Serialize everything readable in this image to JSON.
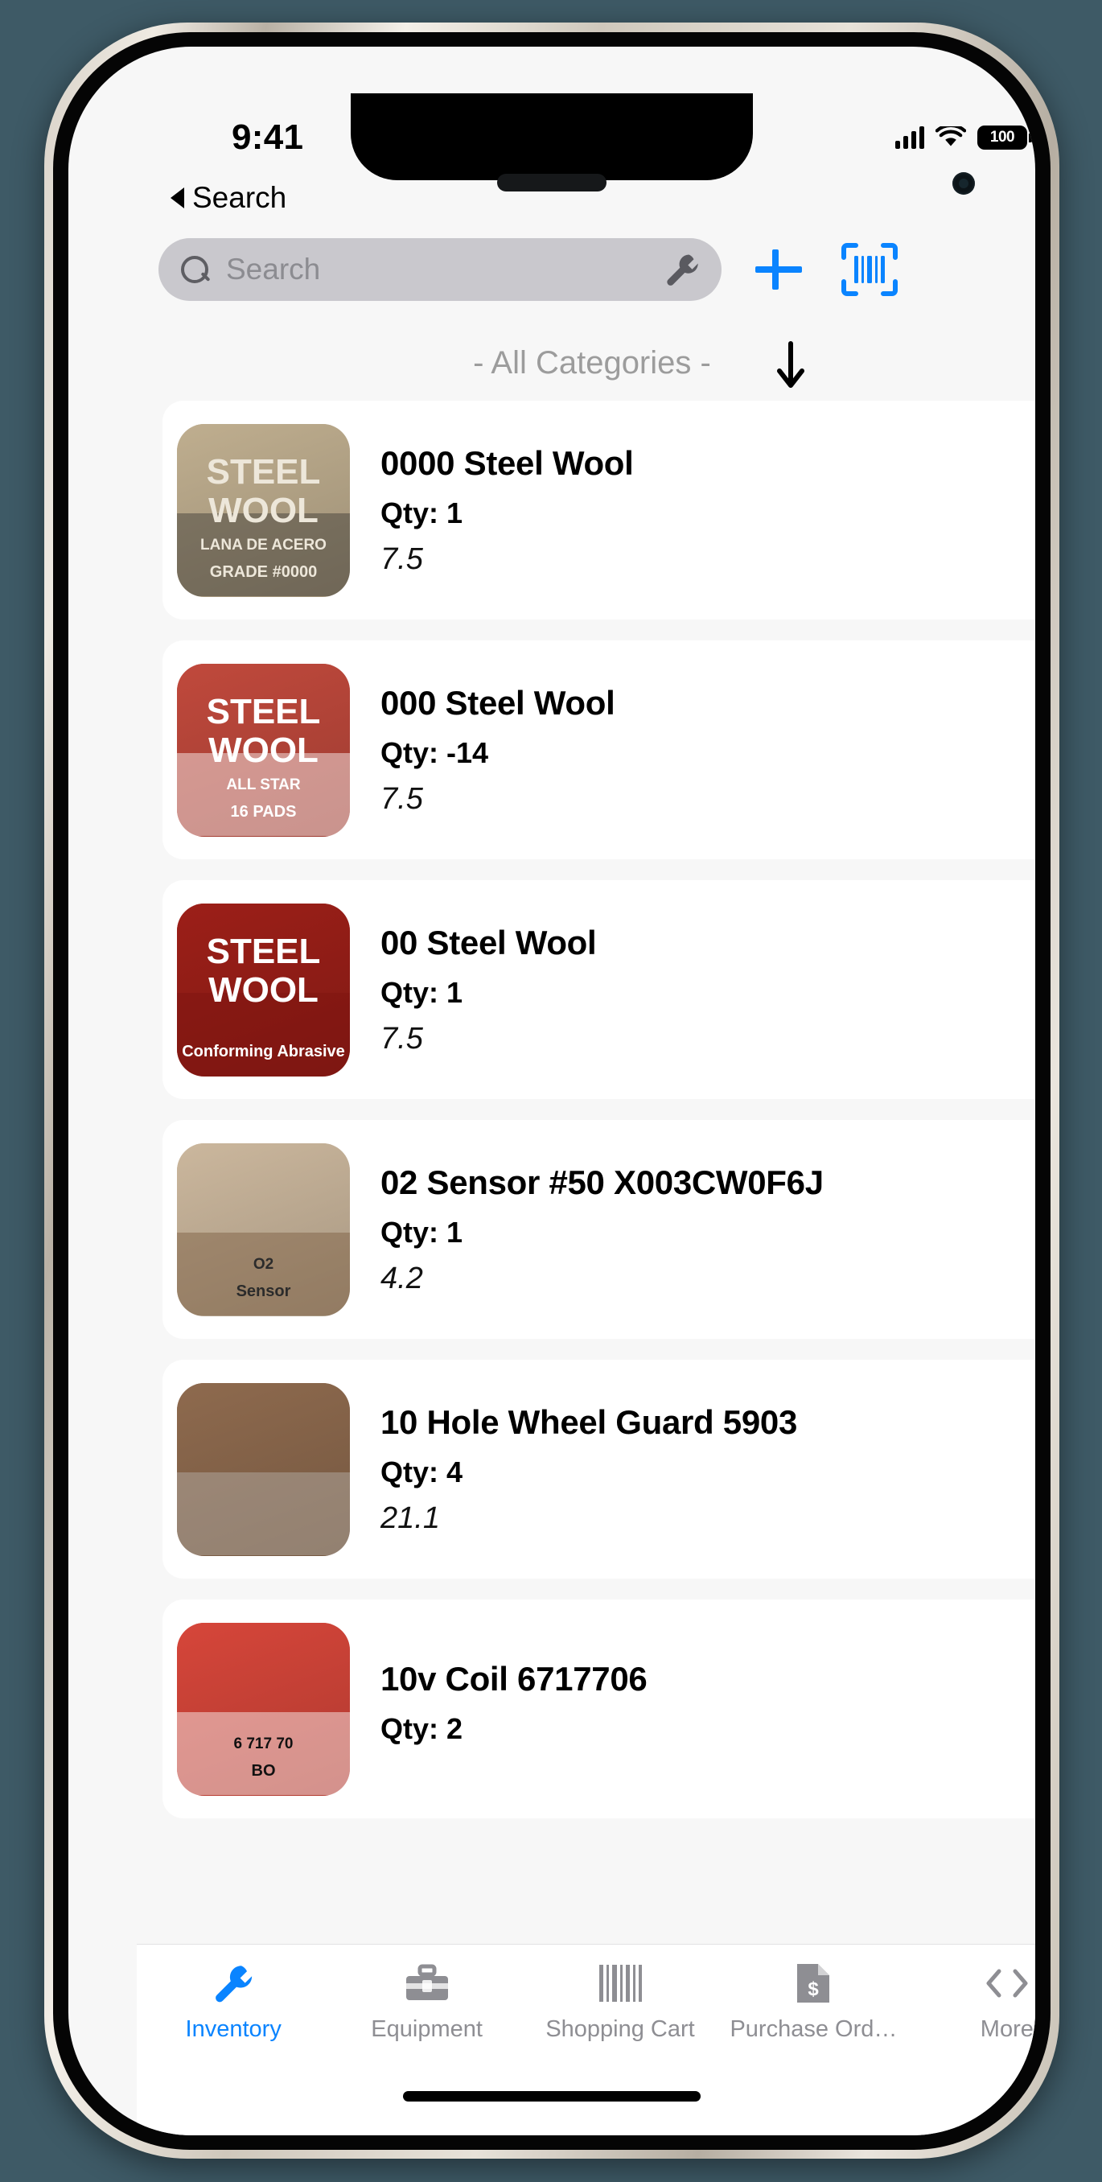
{
  "status_bar": {
    "time": "9:41",
    "battery_level": "100",
    "signal_icon": "cellular-bars-icon",
    "wifi_icon": "wifi-icon",
    "battery_icon": "battery-icon"
  },
  "nav": {
    "back_label": "Search",
    "back_icon": "chevron-left-icon"
  },
  "search": {
    "placeholder": "Search",
    "value": "",
    "search_icon": "search-icon",
    "filter_icon": "wrench-icon",
    "add_icon": "plus-icon",
    "scan_icon": "barcode-scan-icon"
  },
  "category": {
    "label": "- All Categories -",
    "sort_icon": "arrow-down-icon"
  },
  "colors": {
    "accent": "#0a84ff",
    "screen_bg": "#f7f7f7",
    "card_bg": "#ffffff",
    "muted_text": "#8e8e93",
    "search_field_bg": "#c9c8cd"
  },
  "items": [
    {
      "title": "0000 Steel Wool",
      "qty_label": "Qty: 1",
      "price": "7.5",
      "thumb_alt": "steel-wool-0000-photo",
      "thumb": {
        "bg": "#bfae8f",
        "band": "#3a3733",
        "line1": "STEEL",
        "line2": "WOOL",
        "sub": "LANA DE ACERO",
        "grade": "GRADE #0000",
        "line_color": "#ede7da"
      }
    },
    {
      "title": "000 Steel Wool",
      "qty_label": "Qty: -14",
      "price": "7.5",
      "thumb_alt": "steel-wool-000-photo",
      "thumb": {
        "bg": "#c0493c",
        "band": "#ffffff",
        "line1": "STEEL",
        "line2": "WOOL",
        "sub": "ALL STAR",
        "grade": "16 PADS",
        "line_color": "#ffffff"
      }
    },
    {
      "title": "00 Steel Wool",
      "qty_label": "Qty: 1",
      "price": "7.5",
      "thumb_alt": "steel-wool-00-photo",
      "thumb": {
        "bg": "#9c1f18",
        "band": "#7d1510",
        "line1": "STEEL",
        "line2": "WOOL",
        "sub": "",
        "grade": "Conforming Abrasive",
        "line_color": "#ffffff"
      }
    },
    {
      "title": "02 Sensor #50 X003CW0F6J",
      "qty_label": "Qty: 1",
      "price": "4.2",
      "thumb_alt": "o2-sensor-box-photo",
      "thumb": {
        "bg": "#cbb79d",
        "band": "#7a5c3d",
        "line1": "",
        "line2": "",
        "sub": "O2",
        "grade": "Sensor",
        "line_color": "#2b2b2b"
      }
    },
    {
      "title": "10 Hole Wheel Guard 5903",
      "qty_label": "Qty: 4",
      "price": "21.1",
      "thumb_alt": "wheel-guard-photo",
      "thumb": {
        "bg": "#8e6a4e",
        "band": "#b9b4ad",
        "line1": "",
        "line2": "",
        "sub": "",
        "grade": "",
        "line_color": "#2f6fbf"
      }
    },
    {
      "title": "10v Coil 6717706",
      "qty_label": "Qty: 2",
      "price": "",
      "thumb_alt": "coil-barcode-photo",
      "thumb": {
        "bg": "#d6463a",
        "band": "#ffffff",
        "line1": "",
        "line2": "",
        "sub": "6 717 70",
        "grade": "BO",
        "line_color": "#111111"
      }
    }
  ],
  "tabs": [
    {
      "label": "Inventory",
      "icon": "wrench-icon",
      "active": true
    },
    {
      "label": "Equipment",
      "icon": "toolbox-icon",
      "active": false
    },
    {
      "label": "Shopping Cart",
      "icon": "barcode-icon",
      "active": false
    },
    {
      "label": "Purchase Ord…",
      "icon": "document-dollar-icon",
      "active": false
    },
    {
      "label": "More",
      "icon": "chevron-pair-icon",
      "active": false
    }
  ]
}
